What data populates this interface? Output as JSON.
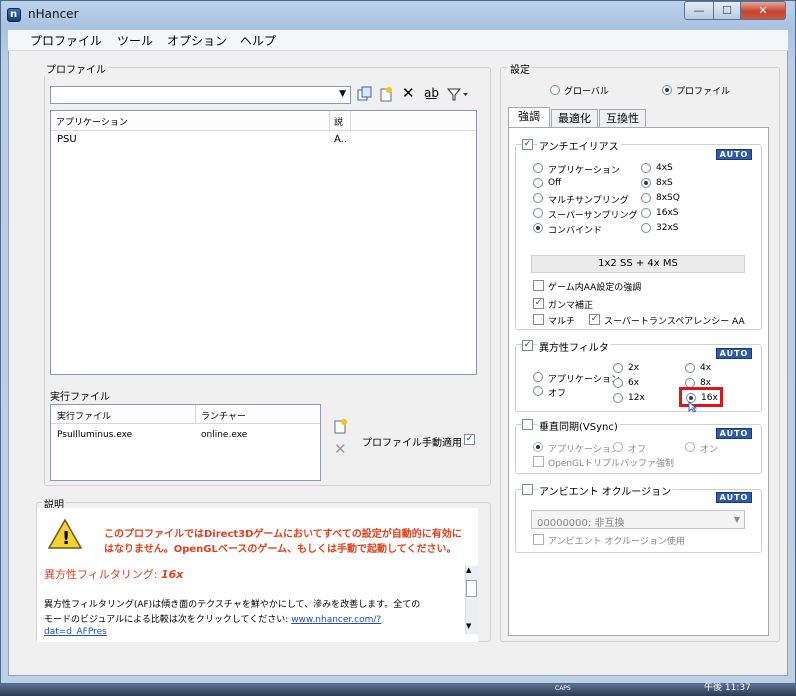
{
  "window": {
    "title": "nHancer",
    "min_glyph": "—",
    "max_glyph": "☐",
    "close_glyph": "✕"
  },
  "menu": [
    "プロファイル",
    "ツール",
    "オプション",
    "ヘルプ"
  ],
  "profile": {
    "group_label": "プロファイル",
    "table_headers": [
      "アプリケーション",
      "説"
    ],
    "rows": [
      {
        "app": "PSU",
        "desc": "A.."
      }
    ]
  },
  "exec": {
    "group_label": "実行ファイル",
    "headers": [
      "実行ファイル",
      "ランチャー"
    ],
    "rows": [
      {
        "file": "PsuIlluminus.exe",
        "launcher": "online.exe"
      }
    ],
    "manual_apply_label": "プロファイル手動適用"
  },
  "description": {
    "group_label": "説明",
    "warning_line1": "このプロファイルではDirect3Dゲームにおいてすべての設定が自動的に有効に",
    "warning_line2": "はなりません。OpenGLベースのゲーム、もしくは手動で起動してください。",
    "heading": "異方性フィルタリング: ",
    "heading_value": "16x",
    "body_line1": "異方性フィルタリング(AF)は傾き面のテクスチャを鮮やかにして、滲みを改善します。全ての",
    "body_line2": "モードのビジュアルによる比較は次をクリックしてください: ",
    "link_part1": "www.nhancer.com/?",
    "link_part2": "dat=d_AFPres"
  },
  "settings": {
    "group_label": "設定",
    "scope_global": "グローバル",
    "scope_profile": "プロファイル",
    "tabs": [
      "強調",
      "最適化",
      "互換性"
    ],
    "auto_label": "AUTO",
    "aa": {
      "label": "アンチエイリアス",
      "left_options": [
        "アプリケーション",
        "Off",
        "マルチサンプリング",
        "スーパーサンプリング",
        "コンバインド"
      ],
      "right_options": [
        "4xS",
        "8xS",
        "8xSQ",
        "16xS",
        "32xS"
      ],
      "mode_display": "1x2 SS + 4x MS",
      "ingame_label": "ゲーム内AA設定の強調",
      "gamma_label": "ガンマ補正",
      "multi_label": "マルチ",
      "super_label": "スーパー",
      "transparency_label": "トランスペアレンシー AA"
    },
    "af": {
      "label": "異方性フィルタ",
      "app_label": "アプリケーション",
      "off_label": "オフ",
      "levels": [
        "2x",
        "4x",
        "6x",
        "8x",
        "12x",
        "16x"
      ]
    },
    "vsync": {
      "label": "垂直同期(VSync)",
      "options": [
        "アプリケーション",
        "オフ",
        "オン"
      ],
      "triple_label": "OpenGLトリプルバッファ強制"
    },
    "ao": {
      "label": "アンビエント オクルージョン",
      "select_value": "00000000: 非互換",
      "use_label": "アンビエント オクルージョン使用"
    }
  },
  "taskbar": {
    "time": "午後 11:37",
    "caps": "CAPS"
  }
}
